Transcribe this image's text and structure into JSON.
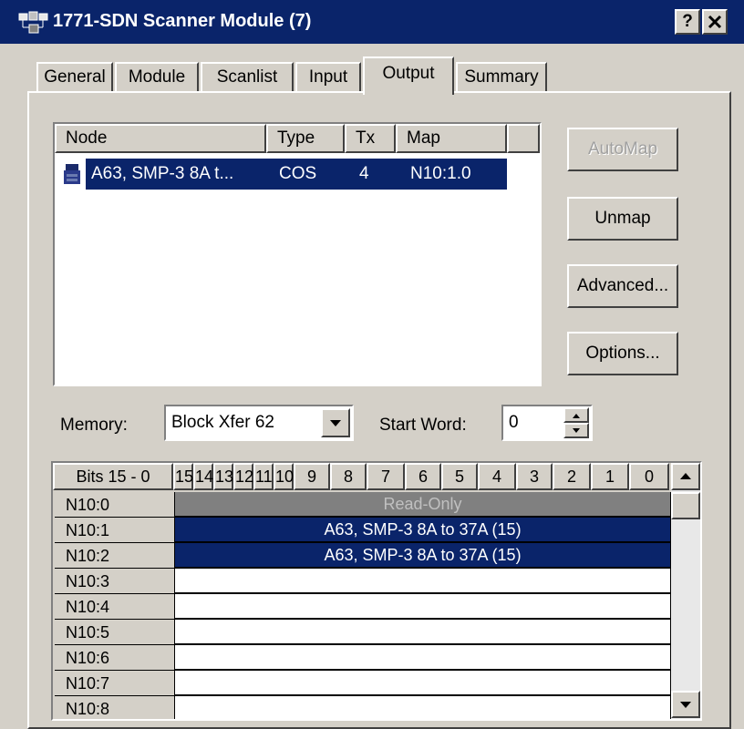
{
  "window": {
    "title": "1771-SDN Scanner Module (7)",
    "help_label": "?",
    "close_label": "✕",
    "icon": "network-module-icon"
  },
  "tabs": [
    {
      "label": "General"
    },
    {
      "label": "Module"
    },
    {
      "label": "Scanlist"
    },
    {
      "label": "Input"
    },
    {
      "label": "Output"
    },
    {
      "label": "Summary"
    }
  ],
  "active_tab": "Output",
  "node_list": {
    "columns": [
      "Node",
      "Type",
      "Tx",
      "Map"
    ],
    "rows": [
      {
        "icon": "device-icon",
        "node": "A63, SMP-3 8A t...",
        "type": "COS",
        "tx": "4",
        "map": "N10:1.0"
      }
    ]
  },
  "buttons": {
    "automap": "AutoMap",
    "unmap": "Unmap",
    "advanced": "Advanced...",
    "options": "Options..."
  },
  "memory": {
    "label": "Memory:",
    "value": "Block Xfer 62"
  },
  "start_word": {
    "label": "Start Word:",
    "value": "0"
  },
  "bit_grid": {
    "header_label": "Bits 15 - 0",
    "bits": [
      "15",
      "14",
      "13",
      "12",
      "11",
      "10",
      "9",
      "8",
      "7",
      "6",
      "5",
      "4",
      "3",
      "2",
      "1",
      "0"
    ],
    "rows": [
      {
        "word": "N10:0",
        "content": "Read-Only",
        "state": "read-only"
      },
      {
        "word": "N10:1",
        "content": "A63, SMP-3 8A to 37A (15)",
        "state": "mapped"
      },
      {
        "word": "N10:2",
        "content": "A63, SMP-3 8A to 37A (15)",
        "state": "mapped"
      },
      {
        "word": "N10:3",
        "content": "",
        "state": "empty"
      },
      {
        "word": "N10:4",
        "content": "",
        "state": "empty"
      },
      {
        "word": "N10:5",
        "content": "",
        "state": "empty"
      },
      {
        "word": "N10:6",
        "content": "",
        "state": "empty"
      },
      {
        "word": "N10:7",
        "content": "",
        "state": "empty"
      },
      {
        "word": "N10:8",
        "content": "",
        "state": "empty"
      }
    ]
  },
  "colors": {
    "selection": "#0a246a",
    "face": "#d4d0c8",
    "read_only": "#808080"
  }
}
